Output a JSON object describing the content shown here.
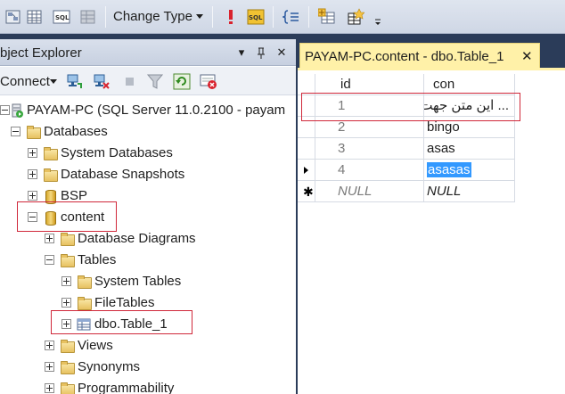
{
  "toolbar": {
    "change_type_label": "Change Type",
    "icons": [
      "diagram-pane-icon",
      "grid-pane-icon",
      "sql-pane-icon",
      "results-pane-icon",
      "execute-sql-icon",
      "verify-sql-icon",
      "group-by-icon",
      "add-table-icon",
      "add-derived-table-icon",
      "toolbar-options-icon"
    ]
  },
  "object_explorer": {
    "title": "bject Explorer",
    "connect_label": "Connect",
    "tree": {
      "server": "PAYAM-PC (SQL Server 11.0.2100 - payam",
      "databases": "Databases",
      "system_databases": "System Databases",
      "database_snapshots": "Database Snapshots",
      "bsp": "BSP",
      "content": "content",
      "database_diagrams": "Database Diagrams",
      "tables": "Tables",
      "system_tables": "System Tables",
      "file_tables": "FileTables",
      "dbo_table_1": "dbo.Table_1",
      "views": "Views",
      "synonyms": "Synonyms",
      "programmability": "Programmability"
    }
  },
  "document_tab": {
    "label": "PAYAM-PC.content - dbo.Table_1",
    "close": "✕"
  },
  "grid": {
    "columns": [
      "id",
      "con"
    ],
    "rows": [
      {
        "id": "1",
        "con": "... این متن جهت"
      },
      {
        "id": "2",
        "con": "bingo"
      },
      {
        "id": "3",
        "con": "asas"
      },
      {
        "id": "4",
        "con": "asasas"
      }
    ],
    "new_row": {
      "id": "NULL",
      "con": "NULL"
    }
  },
  "colors": {
    "accent_highlight": "#3399ff",
    "annotation_red": "#d0283a",
    "tab_yellow": "#fff1a8",
    "ide_background": "#2b3c59"
  }
}
